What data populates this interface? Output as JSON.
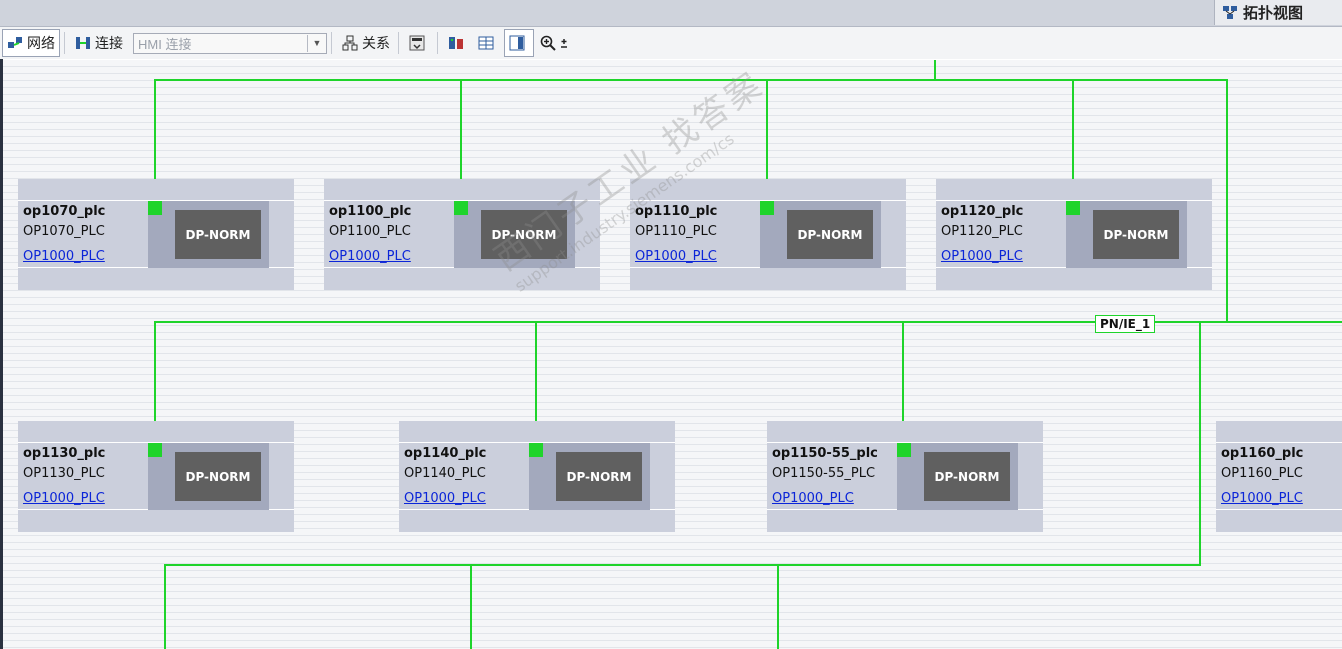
{
  "window": {
    "view_tab_label": "拓扑视图"
  },
  "toolbar": {
    "network_label": "网络",
    "connection_label": "连接",
    "connection_select_value": "HMI 连接",
    "relation_label": "关系"
  },
  "network": {
    "subnet_label": "PN/IE_1",
    "line_color": "#1fd42b"
  },
  "devices": [
    {
      "name": "op1070_plc",
      "type": "OP1070_PLC",
      "link": "OP1000_PLC",
      "module": "DP-NORM"
    },
    {
      "name": "op1100_plc",
      "type": "OP1100_PLC",
      "link": "OP1000_PLC",
      "module": "DP-NORM"
    },
    {
      "name": "op1110_plc",
      "type": "OP1110_PLC",
      "link": "OP1000_PLC",
      "module": "DP-NORM"
    },
    {
      "name": "op1120_plc",
      "type": "OP1120_PLC",
      "link": "OP1000_PLC",
      "module": "DP-NORM"
    },
    {
      "name": "op1130_plc",
      "type": "OP1130_PLC",
      "link": "OP1000_PLC",
      "module": "DP-NORM"
    },
    {
      "name": "op1140_plc",
      "type": "OP1140_PLC",
      "link": "OP1000_PLC",
      "module": "DP-NORM"
    },
    {
      "name": "op1150-55_plc",
      "type": "OP1150-55_PLC",
      "link": "OP1000_PLC",
      "module": "DP-NORM"
    },
    {
      "name": "op1160_plc",
      "type": "OP1160_PLC",
      "link": "OP1000_PLC",
      "module": ""
    }
  ],
  "watermark": {
    "line1": "西门子工业  找答案",
    "line2": "support.industry.siemens.com/cs"
  },
  "colors": {
    "card_bg": "#cbcfdc",
    "module_bg": "#a3a9bd",
    "dp_bg": "#606060",
    "link": "#0b25d8"
  }
}
